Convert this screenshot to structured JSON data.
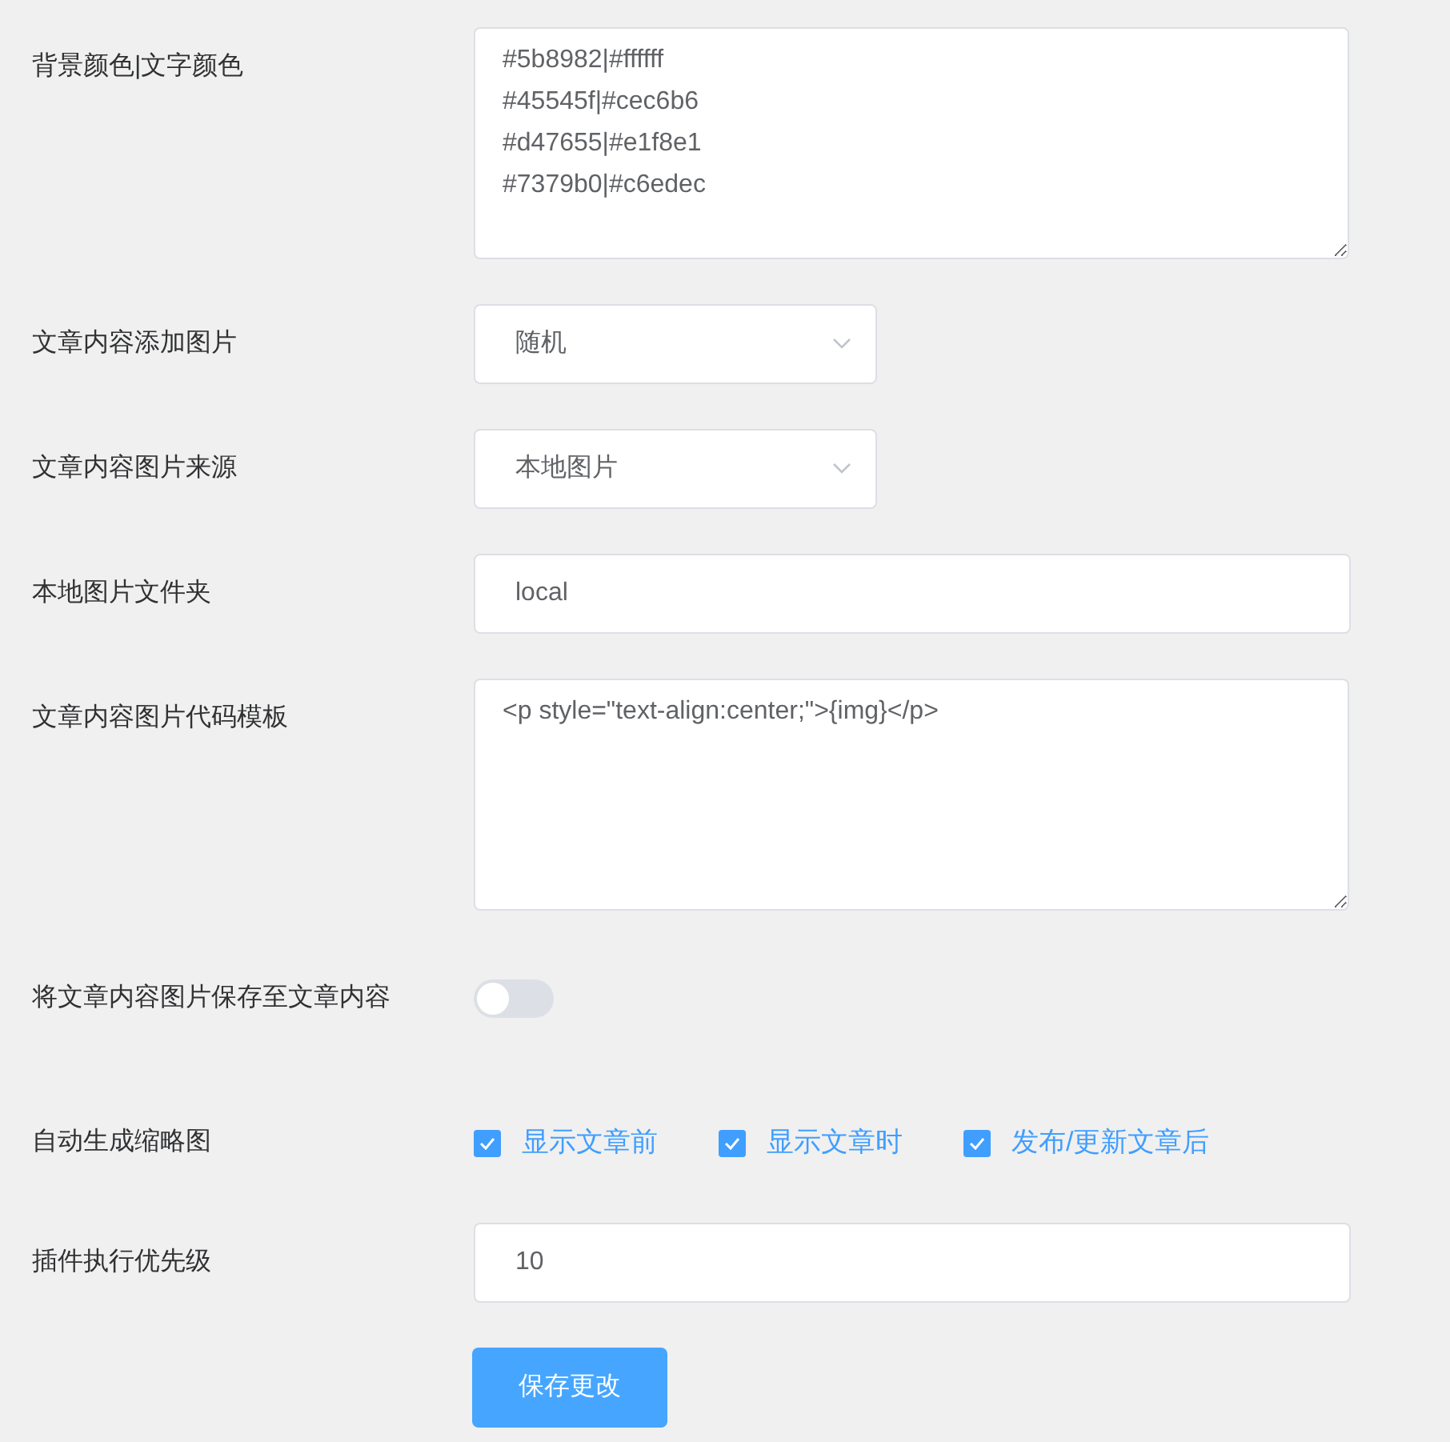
{
  "fields": [
    {
      "kind": "textarea",
      "label": "背景颜色|文字颜色",
      "value": "#5b8982|#ffffff\n#45545f|#cec6b6\n#d47655|#e1f8e1\n#7379b0|#c6edec"
    },
    {
      "kind": "select",
      "label": "文章内容添加图片",
      "value": "随机"
    },
    {
      "kind": "select",
      "label": "文章内容图片来源",
      "value": "本地图片"
    },
    {
      "kind": "input",
      "label": "本地图片文件夹",
      "value": "local"
    },
    {
      "kind": "textarea",
      "label": "文章内容图片代码模板",
      "value": "<p style=\"text-align:center;\">{img}</p>"
    },
    {
      "kind": "switch",
      "label": "将文章内容图片保存至文章内容",
      "on": false
    },
    {
      "kind": "checkboxes",
      "label": "自动生成缩略图",
      "options": [
        {
          "label": "显示文章前",
          "checked": true
        },
        {
          "label": "显示文章时",
          "checked": true
        },
        {
          "label": "发布/更新文章后",
          "checked": true
        }
      ]
    },
    {
      "kind": "input",
      "label": "插件执行优先级",
      "value": "10"
    }
  ],
  "save_button": "保存更改"
}
